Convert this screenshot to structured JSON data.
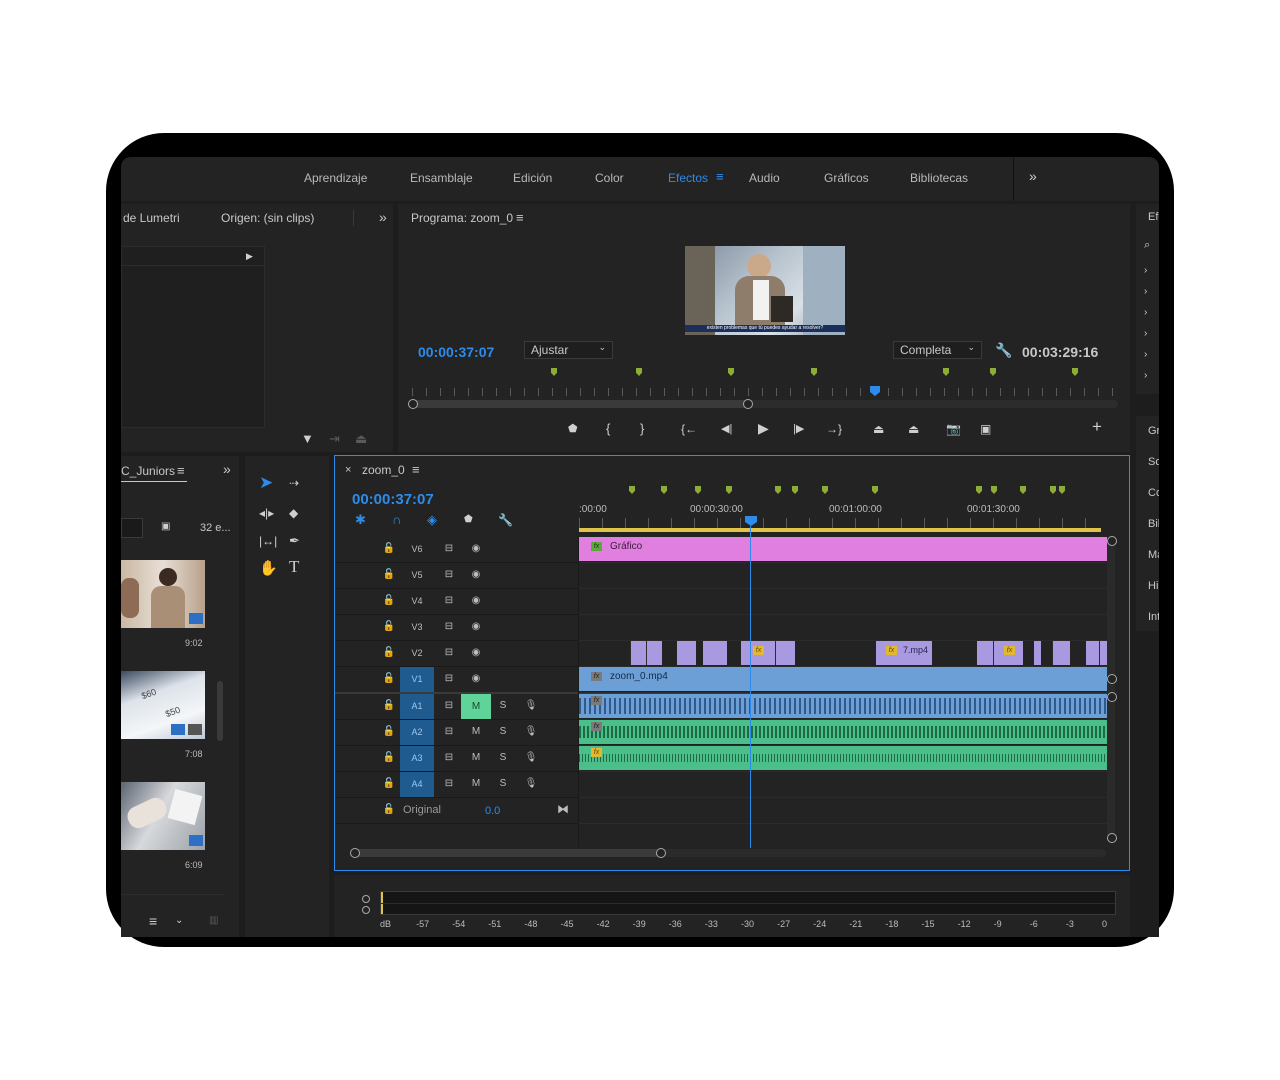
{
  "workspaces": {
    "tabs": [
      "Aprendizaje",
      "Ensamblaje",
      "Edición",
      "Color",
      "Efectos",
      "Audio",
      "Gráficos",
      "Bibliotecas"
    ],
    "active": "Efectos",
    "overflow": "»"
  },
  "source_panel": {
    "tab_lumetri": "de Lumetri",
    "tab_source": "Origen: (sin clips)",
    "overflow": "»"
  },
  "program_monitor": {
    "title": "Programa: zoom_0",
    "menu_icon": "≡",
    "timecode": "00:00:37:07",
    "fit": "Ajustar",
    "quality": "Completa",
    "duration": "00:03:29:16",
    "subtitle": "existen problemas que tú puedes ayudar a resolver?",
    "playhead_fraction": 0.665,
    "inout_fraction": 0.475
  },
  "effects_panel": {
    "title": "Efe",
    "items": [
      "Gr",
      "So",
      "Co",
      "Bil",
      "Ma",
      "Hi",
      "Int"
    ]
  },
  "project_panel": {
    "title": "C_Juniors",
    "count": "32 e...",
    "items": [
      {
        "duration": "9:02"
      },
      {
        "duration": "7:08"
      },
      {
        "duration": "6:09"
      }
    ]
  },
  "tools": [
    "selection-tool",
    "track-select-tool",
    "ripple-edit-tool",
    "razor-tool",
    "slip-tool",
    "pen-tool",
    "hand-tool",
    "type-tool"
  ],
  "timeline": {
    "sequence_name": "zoom_0",
    "close": "×",
    "menu_icon": "≡",
    "timecode": "00:00:37:07",
    "ruler": [
      ":00:00",
      "00:00:30:00",
      "00:01:00:00",
      "00:01:30:00"
    ],
    "tracks_video": [
      "V6",
      "V5",
      "V4",
      "V3",
      "V2",
      "V1"
    ],
    "tracks_audio": [
      "A1",
      "A2",
      "A3",
      "A4"
    ],
    "track_mute": "M",
    "track_solo": "S",
    "master_label": "Original",
    "master_value": "0.0",
    "clips": {
      "graphic": "Gráfico",
      "v1": "zoom_0.mp4",
      "v2_label": "7.mp4"
    },
    "fx_label": "fx"
  },
  "audio_meter": {
    "scale": [
      "dB",
      "-57",
      "-54",
      "-51",
      "-48",
      "-45",
      "-42",
      "-39",
      "-36",
      "-33",
      "-30",
      "-27",
      "-24",
      "-21",
      "-18",
      "-15",
      "-12",
      "-9",
      "-6",
      "-3",
      "0"
    ]
  },
  "colors": {
    "accent_blue": "#2d8ceb",
    "graphic_clip": "#e07fe0",
    "video_clip": "#a999e0",
    "v1_clip": "#6b9fd6",
    "audio_clip": "#4bbf8a",
    "marker_green": "#8cae38"
  }
}
